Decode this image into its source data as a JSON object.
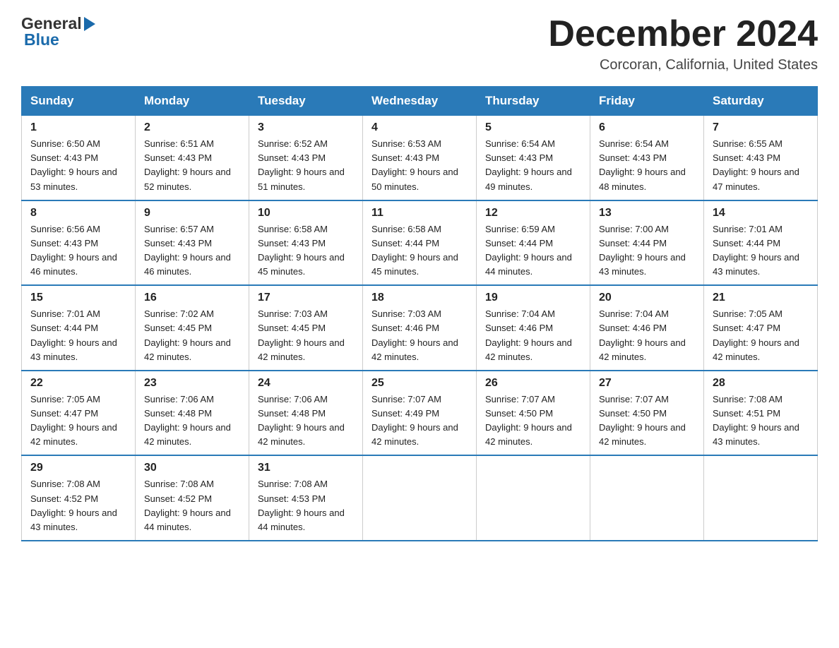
{
  "header": {
    "logo": {
      "general": "General",
      "blue": "Blue"
    },
    "title": "December 2024",
    "location": "Corcoran, California, United States"
  },
  "calendar": {
    "days_of_week": [
      "Sunday",
      "Monday",
      "Tuesday",
      "Wednesday",
      "Thursday",
      "Friday",
      "Saturday"
    ],
    "weeks": [
      [
        {
          "day": "1",
          "sunrise": "Sunrise: 6:50 AM",
          "sunset": "Sunset: 4:43 PM",
          "daylight": "Daylight: 9 hours and 53 minutes."
        },
        {
          "day": "2",
          "sunrise": "Sunrise: 6:51 AM",
          "sunset": "Sunset: 4:43 PM",
          "daylight": "Daylight: 9 hours and 52 minutes."
        },
        {
          "day": "3",
          "sunrise": "Sunrise: 6:52 AM",
          "sunset": "Sunset: 4:43 PM",
          "daylight": "Daylight: 9 hours and 51 minutes."
        },
        {
          "day": "4",
          "sunrise": "Sunrise: 6:53 AM",
          "sunset": "Sunset: 4:43 PM",
          "daylight": "Daylight: 9 hours and 50 minutes."
        },
        {
          "day": "5",
          "sunrise": "Sunrise: 6:54 AM",
          "sunset": "Sunset: 4:43 PM",
          "daylight": "Daylight: 9 hours and 49 minutes."
        },
        {
          "day": "6",
          "sunrise": "Sunrise: 6:54 AM",
          "sunset": "Sunset: 4:43 PM",
          "daylight": "Daylight: 9 hours and 48 minutes."
        },
        {
          "day": "7",
          "sunrise": "Sunrise: 6:55 AM",
          "sunset": "Sunset: 4:43 PM",
          "daylight": "Daylight: 9 hours and 47 minutes."
        }
      ],
      [
        {
          "day": "8",
          "sunrise": "Sunrise: 6:56 AM",
          "sunset": "Sunset: 4:43 PM",
          "daylight": "Daylight: 9 hours and 46 minutes."
        },
        {
          "day": "9",
          "sunrise": "Sunrise: 6:57 AM",
          "sunset": "Sunset: 4:43 PM",
          "daylight": "Daylight: 9 hours and 46 minutes."
        },
        {
          "day": "10",
          "sunrise": "Sunrise: 6:58 AM",
          "sunset": "Sunset: 4:43 PM",
          "daylight": "Daylight: 9 hours and 45 minutes."
        },
        {
          "day": "11",
          "sunrise": "Sunrise: 6:58 AM",
          "sunset": "Sunset: 4:44 PM",
          "daylight": "Daylight: 9 hours and 45 minutes."
        },
        {
          "day": "12",
          "sunrise": "Sunrise: 6:59 AM",
          "sunset": "Sunset: 4:44 PM",
          "daylight": "Daylight: 9 hours and 44 minutes."
        },
        {
          "day": "13",
          "sunrise": "Sunrise: 7:00 AM",
          "sunset": "Sunset: 4:44 PM",
          "daylight": "Daylight: 9 hours and 43 minutes."
        },
        {
          "day": "14",
          "sunrise": "Sunrise: 7:01 AM",
          "sunset": "Sunset: 4:44 PM",
          "daylight": "Daylight: 9 hours and 43 minutes."
        }
      ],
      [
        {
          "day": "15",
          "sunrise": "Sunrise: 7:01 AM",
          "sunset": "Sunset: 4:44 PM",
          "daylight": "Daylight: 9 hours and 43 minutes."
        },
        {
          "day": "16",
          "sunrise": "Sunrise: 7:02 AM",
          "sunset": "Sunset: 4:45 PM",
          "daylight": "Daylight: 9 hours and 42 minutes."
        },
        {
          "day": "17",
          "sunrise": "Sunrise: 7:03 AM",
          "sunset": "Sunset: 4:45 PM",
          "daylight": "Daylight: 9 hours and 42 minutes."
        },
        {
          "day": "18",
          "sunrise": "Sunrise: 7:03 AM",
          "sunset": "Sunset: 4:46 PM",
          "daylight": "Daylight: 9 hours and 42 minutes."
        },
        {
          "day": "19",
          "sunrise": "Sunrise: 7:04 AM",
          "sunset": "Sunset: 4:46 PM",
          "daylight": "Daylight: 9 hours and 42 minutes."
        },
        {
          "day": "20",
          "sunrise": "Sunrise: 7:04 AM",
          "sunset": "Sunset: 4:46 PM",
          "daylight": "Daylight: 9 hours and 42 minutes."
        },
        {
          "day": "21",
          "sunrise": "Sunrise: 7:05 AM",
          "sunset": "Sunset: 4:47 PM",
          "daylight": "Daylight: 9 hours and 42 minutes."
        }
      ],
      [
        {
          "day": "22",
          "sunrise": "Sunrise: 7:05 AM",
          "sunset": "Sunset: 4:47 PM",
          "daylight": "Daylight: 9 hours and 42 minutes."
        },
        {
          "day": "23",
          "sunrise": "Sunrise: 7:06 AM",
          "sunset": "Sunset: 4:48 PM",
          "daylight": "Daylight: 9 hours and 42 minutes."
        },
        {
          "day": "24",
          "sunrise": "Sunrise: 7:06 AM",
          "sunset": "Sunset: 4:48 PM",
          "daylight": "Daylight: 9 hours and 42 minutes."
        },
        {
          "day": "25",
          "sunrise": "Sunrise: 7:07 AM",
          "sunset": "Sunset: 4:49 PM",
          "daylight": "Daylight: 9 hours and 42 minutes."
        },
        {
          "day": "26",
          "sunrise": "Sunrise: 7:07 AM",
          "sunset": "Sunset: 4:50 PM",
          "daylight": "Daylight: 9 hours and 42 minutes."
        },
        {
          "day": "27",
          "sunrise": "Sunrise: 7:07 AM",
          "sunset": "Sunset: 4:50 PM",
          "daylight": "Daylight: 9 hours and 42 minutes."
        },
        {
          "day": "28",
          "sunrise": "Sunrise: 7:08 AM",
          "sunset": "Sunset: 4:51 PM",
          "daylight": "Daylight: 9 hours and 43 minutes."
        }
      ],
      [
        {
          "day": "29",
          "sunrise": "Sunrise: 7:08 AM",
          "sunset": "Sunset: 4:52 PM",
          "daylight": "Daylight: 9 hours and 43 minutes."
        },
        {
          "day": "30",
          "sunrise": "Sunrise: 7:08 AM",
          "sunset": "Sunset: 4:52 PM",
          "daylight": "Daylight: 9 hours and 44 minutes."
        },
        {
          "day": "31",
          "sunrise": "Sunrise: 7:08 AM",
          "sunset": "Sunset: 4:53 PM",
          "daylight": "Daylight: 9 hours and 44 minutes."
        },
        null,
        null,
        null,
        null
      ]
    ]
  }
}
